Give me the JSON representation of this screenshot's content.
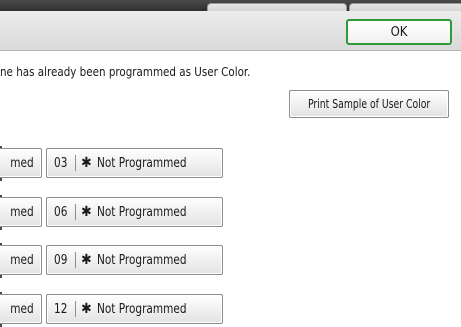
{
  "header": {
    "ok_label": "OK"
  },
  "message": "ne has already been programmed as User Color.",
  "print_sample_label": "Print Sample of User Color",
  "rows": [
    {
      "partial_label": "med",
      "number": "03",
      "star": "✱",
      "label": "Not Programmed"
    },
    {
      "partial_label": "med",
      "number": "06",
      "star": "✱",
      "label": "Not Programmed"
    },
    {
      "partial_label": "med",
      "number": "09",
      "star": "✱",
      "label": "Not Programmed"
    },
    {
      "partial_label": "med",
      "number": "12",
      "star": "✱",
      "label": "Not Programmed"
    }
  ],
  "colors": {
    "ok_border": "#2f9a3a",
    "top_bar": "#2f2f2f",
    "header_band": "#e0e0e0"
  }
}
